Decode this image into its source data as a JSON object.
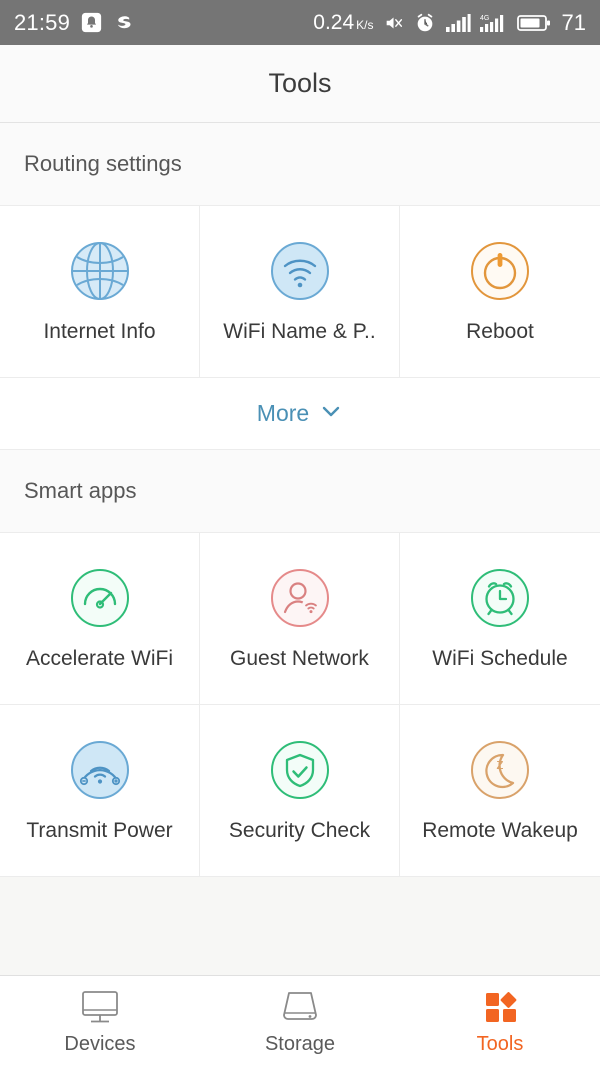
{
  "status_bar": {
    "time": "21:59",
    "left_icons": [
      "notification-icon",
      "sogou-input-icon"
    ],
    "net_rate": "0.24",
    "net_rate_unit_top": "K",
    "net_rate_unit_bottom": "s",
    "right_icons": [
      "mute-icon",
      "alarm-icon",
      "signal-icon",
      "signal-4g-icon",
      "battery-icon"
    ],
    "battery_level": "71",
    "background_color": "#757575",
    "text_color": "#ffffff"
  },
  "header": {
    "title": "Tools"
  },
  "sections": [
    {
      "name": "routing-settings",
      "title": "Routing settings",
      "items": [
        {
          "label": "Internet Info",
          "icon": "globe-icon",
          "color": "#7fb8dd",
          "style": "filled"
        },
        {
          "label": "WiFi Name & P..",
          "icon": "wifi-icon",
          "color": "#7fb8dd",
          "style": "filled"
        },
        {
          "label": "Reboot",
          "icon": "power-icon",
          "color": "#e2963c",
          "style": "outline"
        }
      ],
      "more_label": "More",
      "more_icon": "chevron-down-icon",
      "more_color": "#4a90b5"
    },
    {
      "name": "smart-apps",
      "title": "Smart apps",
      "items": [
        {
          "label": "Accelerate WiFi",
          "icon": "speedometer-icon",
          "color": "#2fbd78",
          "style": "outline"
        },
        {
          "label": "Guest Network",
          "icon": "guest-user-icon",
          "color": "#e58a8a",
          "style": "outline"
        },
        {
          "label": "WiFi Schedule",
          "icon": "alarm-clock-icon",
          "color": "#2fbd78",
          "style": "outline"
        },
        {
          "label": "Transmit Power",
          "icon": "transmit-dial-icon",
          "color": "#7fb8dd",
          "style": "filled"
        },
        {
          "label": "Security Check",
          "icon": "shield-check-icon",
          "color": "#2fbd78",
          "style": "outline"
        },
        {
          "label": "Remote Wakeup",
          "icon": "moon-sleep-icon",
          "color": "#d9a26a",
          "style": "outline"
        }
      ]
    }
  ],
  "bottom_nav": {
    "active": "Tools",
    "active_color": "#f26522",
    "items": [
      {
        "label": "Devices",
        "icon": "monitor-icon",
        "active": false
      },
      {
        "label": "Storage",
        "icon": "drive-icon",
        "active": false
      },
      {
        "label": "Tools",
        "icon": "tools-grid-icon",
        "active": true
      }
    ]
  }
}
